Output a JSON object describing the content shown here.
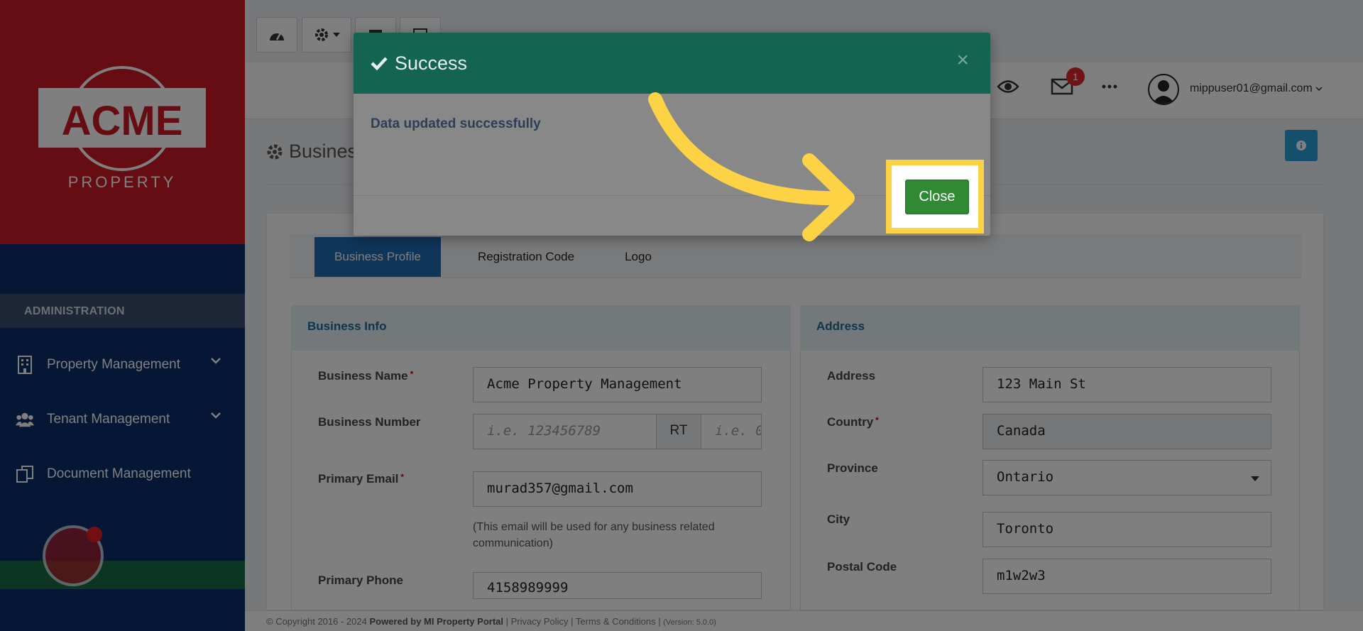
{
  "brand": {
    "logo_main": "ACME",
    "logo_sub": "PROPERTY",
    "red": "#cc1a26",
    "navy": "#0b2f6b"
  },
  "sidebar": {
    "section_title": "ADMINISTRATION",
    "items": [
      {
        "label": "Property Management",
        "icon": "building-icon"
      },
      {
        "label": "Tenant Management",
        "icon": "users-icon"
      },
      {
        "label": "Document Management",
        "icon": "documents-icon"
      }
    ]
  },
  "header": {
    "notifications_count": "1",
    "user_email": "mippuser01@gmail.com"
  },
  "page": {
    "title": "Busines"
  },
  "tabs": [
    {
      "label": "Business Profile",
      "active": true
    },
    {
      "label": "Registration Code",
      "active": false
    },
    {
      "label": "Logo",
      "active": false
    }
  ],
  "business_info": {
    "heading": "Business Info",
    "name_label": "Business Name",
    "name_value": "Acme Property Management",
    "number_label": "Business Number",
    "number_placeholder": "i.e. 123456789",
    "number_addon": "RT",
    "rt_placeholder": "i.e. 0",
    "email_label": "Primary Email",
    "email_value": "murad357@gmail.com",
    "email_help": "(This email will be used for any business related communication)",
    "phone_label": "Primary Phone",
    "phone_value": "4158989999"
  },
  "address": {
    "heading": "Address",
    "address_label": "Address",
    "address_value": "123 Main St",
    "country_label": "Country",
    "country_value": "Canada",
    "province_label": "Province",
    "province_value": "Ontario",
    "city_label": "City",
    "city_value": "Toronto",
    "postal_label": "Postal Code",
    "postal_value": "m1w2w3"
  },
  "footer": {
    "copyright": "© Copyright 2016 - 2024",
    "powered": "Powered by MI Property Portal",
    "links": "| Privacy Policy | Terms & Conditions |",
    "version": "(Version: 5.0.0)"
  },
  "modal": {
    "title": "Success",
    "close_x": "×",
    "message": "Data updated successfully",
    "close_label": "Close"
  },
  "colors": {
    "modal_header": "#146452",
    "close_button": "#2f8a33",
    "highlight": "#fdd245",
    "active_tab": "#1f6ab3"
  }
}
